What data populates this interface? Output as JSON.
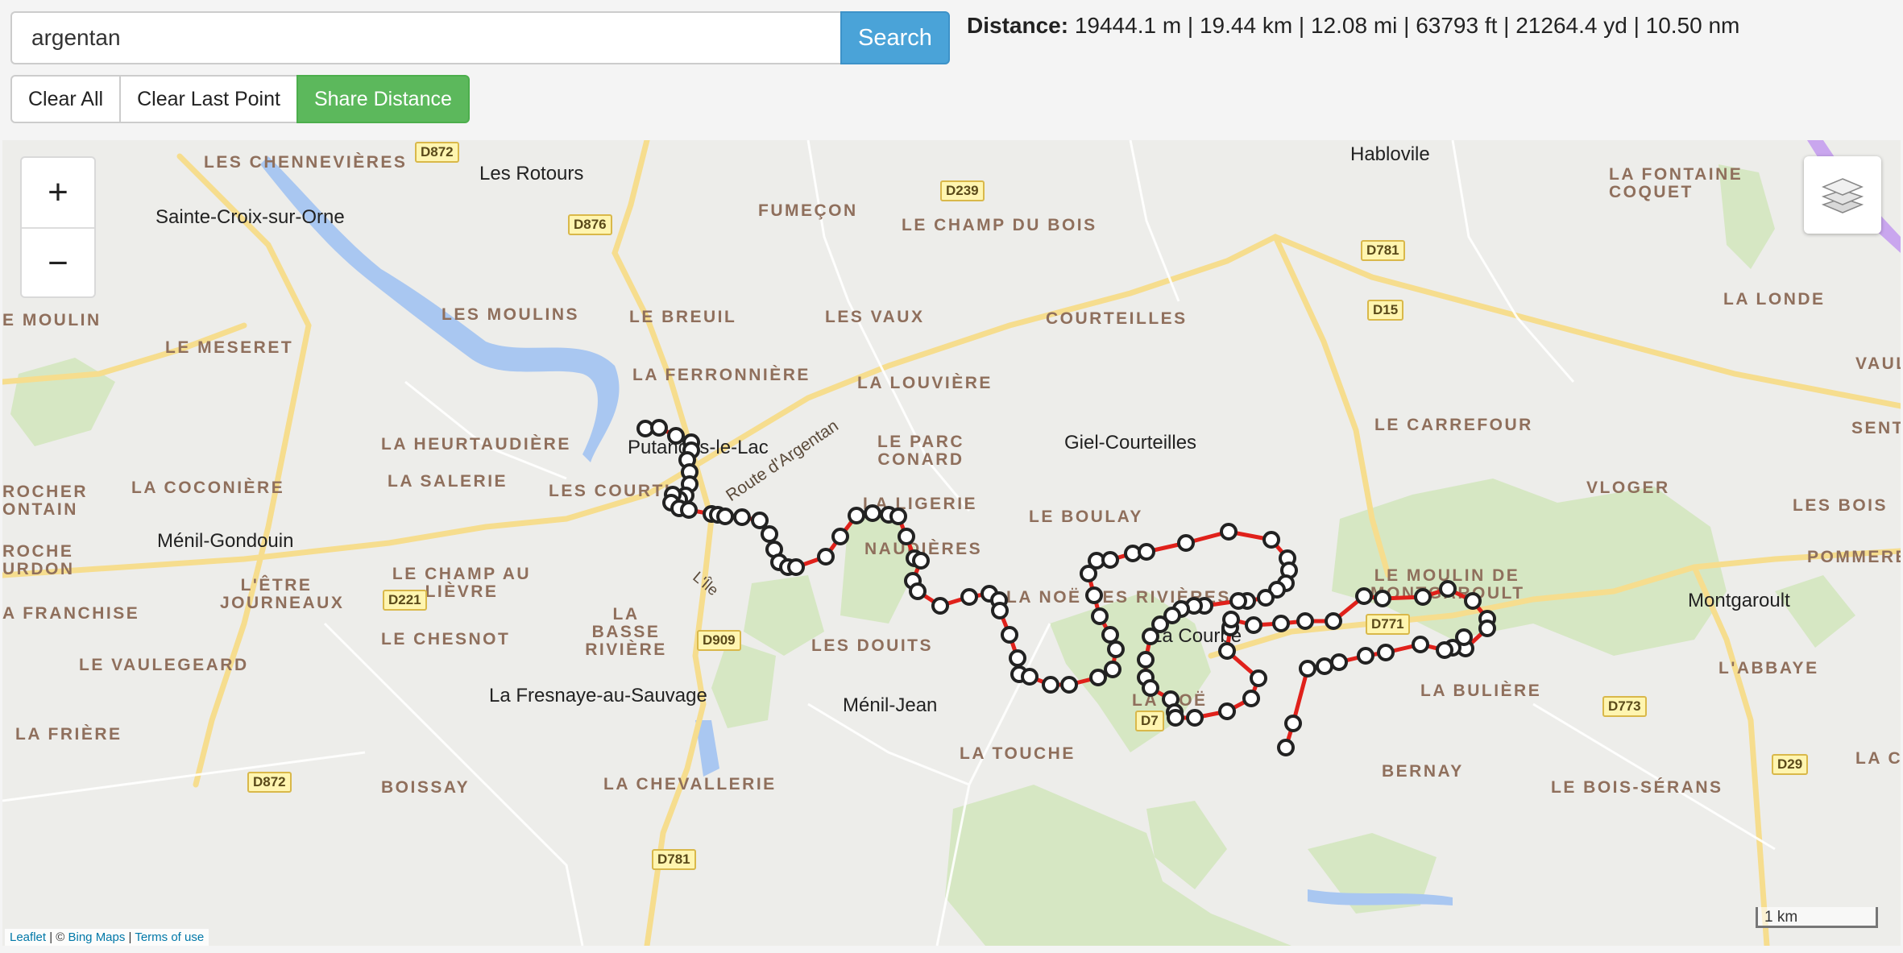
{
  "search": {
    "value": "argentan",
    "button_label": "Search"
  },
  "toolbar": {
    "clear_all": "Clear All",
    "clear_last": "Clear Last Point",
    "share": "Share Distance"
  },
  "distance": {
    "label": "Distance:",
    "text": "19444.1 m | 19.44 km | 12.08 mi | 63793 ft | 21264.4 yd | 10.50 nm"
  },
  "map": {
    "zoom_in": "+",
    "zoom_out": "−",
    "scale": "1 km",
    "attribution": {
      "leaflet": "Leaflet",
      "sep1": " | © ",
      "bing": "Bing Maps",
      "sep2": " | ",
      "terms": "Terms of use"
    },
    "towns": [
      "Les Rotours",
      "Sainte-Croix-sur-Orne",
      "Hablovile",
      "Putanges-le-Lac",
      "Giel-Courteilles",
      "Ménil-Gondouin",
      "Montgaroult",
      "La Fresnaye-au-Sauvage",
      "Ménil-Jean",
      "La Courbe"
    ],
    "localities": [
      "LES CHENNEVIÈRES",
      "FUMEÇON",
      "LE CHAMP DU BOIS",
      "LA FONTAINE COQUET",
      "E MOULIN",
      "LES MOULINS",
      "LE BREUIL",
      "LES VAUX",
      "COURTEILLES",
      "LA LONDE",
      "LE MESERET",
      "LA FERRONNIÈRE",
      "LA LOUVIÈRE",
      "VAULO",
      "LA HEURTAUDIÈRE",
      "LE PARC CONARD",
      "LE CARREFOUR",
      "SENTI",
      "LA SALERIE",
      "LA COCONIÈRE",
      "LES COURTI",
      "LA LIGERIE",
      "LE BOULAY",
      "VLOGER",
      "LES BOIS",
      "ROCHER ONTAIN",
      "ROCHE URDON",
      "LE CHAMP AU LIÈVRE",
      "L'ÊTRE JOURNEAUX",
      "LA NOË DES RIVIÈRES",
      "LE MOULIN DE MONTGAROULT",
      "POMMEREL",
      "A FRANCHISE",
      "LA BASSE RIVIÈRE",
      "LE CHESNOT",
      "LES DOUITS",
      "LE VAULEGEARD",
      "L'ABBAYE",
      "LA NOË",
      "LA BULIÈRE",
      "LA FRIÈRE",
      "LA TOUCHE",
      "BERNAY",
      "LA CO",
      "BOISSAY",
      "LA CHEVALLERIE",
      "LE BOIS-SÉRANS",
      "NAUDIÈRES"
    ],
    "roads": [
      "D872",
      "D239",
      "D876",
      "D781",
      "D15",
      "D221",
      "D909",
      "D771",
      "D773",
      "D29",
      "D872",
      "D781",
      "D7"
    ],
    "road_names": [
      "Route d'Argentan",
      "L'Île"
    ]
  },
  "colors": {
    "route": "#e0211b",
    "search": "#4aa3d8",
    "share": "#5cb85c",
    "water": "#a8c6f0",
    "forest": "#d5e6c2"
  }
}
